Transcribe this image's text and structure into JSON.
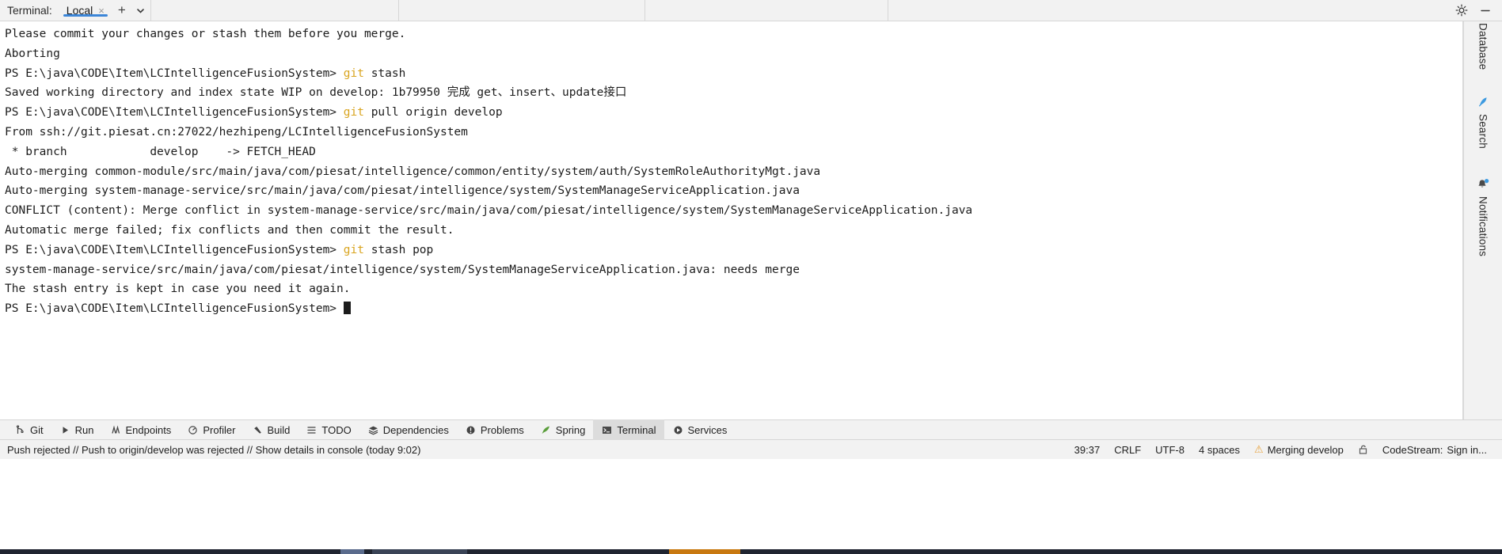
{
  "tabbar": {
    "label": "Terminal:",
    "tabs": [
      {
        "name": "Local",
        "close": "×",
        "active": true
      }
    ],
    "add_button": "+",
    "dropdown_button": "⌵",
    "settings_icon": "gear-icon",
    "minimize_icon": "minimize-icon"
  },
  "terminal": {
    "lines": [
      {
        "text": "Please commit your changes or stash them before you merge."
      },
      {
        "text": "Aborting"
      },
      {
        "prompt": "PS E:\\java\\CODE\\Item\\LCIntelligenceFusionSystem> ",
        "cmd_kw": "git",
        "cmd_rest": " stash"
      },
      {
        "text": "Saved working directory and index state WIP on develop: 1b79950 完成 get、insert、update接口"
      },
      {
        "prompt": "PS E:\\java\\CODE\\Item\\LCIntelligenceFusionSystem> ",
        "cmd_kw": "git",
        "cmd_rest": " pull origin develop"
      },
      {
        "text": "From ssh://git.piesat.cn:27022/hezhipeng/LCIntelligenceFusionSystem"
      },
      {
        "text": " * branch            develop    -> FETCH_HEAD"
      },
      {
        "text": "Auto-merging common-module/src/main/java/com/piesat/intelligence/common/entity/system/auth/SystemRoleAuthorityMgt.java"
      },
      {
        "text": "Auto-merging system-manage-service/src/main/java/com/piesat/intelligence/system/SystemManageServiceApplication.java"
      },
      {
        "text": "CONFLICT (content): Merge conflict in system-manage-service/src/main/java/com/piesat/intelligence/system/SystemManageServiceApplication.java"
      },
      {
        "text": "Automatic merge failed; fix conflicts and then commit the result."
      },
      {
        "prompt": "PS E:\\java\\CODE\\Item\\LCIntelligenceFusionSystem> ",
        "cmd_kw": "git",
        "cmd_rest": " stash pop"
      },
      {
        "text": "system-manage-service/src/main/java/com/piesat/intelligence/system/SystemManageServiceApplication.java: needs merge"
      },
      {
        "text": "The stash entry is kept in case you need it again."
      },
      {
        "prompt": "PS E:\\java\\CODE\\Item\\LCIntelligenceFusionSystem> ",
        "cursor": true
      }
    ]
  },
  "rightbar": {
    "items": [
      {
        "label": "Database",
        "icon": "database-icon"
      },
      {
        "label": "Search",
        "icon": "search-feather-icon"
      },
      {
        "label": "Notifications",
        "icon": "bell-icon"
      }
    ]
  },
  "bottombar": {
    "items": [
      {
        "label": "Git",
        "icon": "git-branch-icon",
        "active": false
      },
      {
        "label": "Run",
        "icon": "play-icon",
        "active": false
      },
      {
        "label": "Endpoints",
        "icon": "endpoints-icon",
        "active": false
      },
      {
        "label": "Profiler",
        "icon": "profiler-icon",
        "active": false
      },
      {
        "label": "Build",
        "icon": "hammer-icon",
        "active": false
      },
      {
        "label": "TODO",
        "icon": "list-icon",
        "active": false
      },
      {
        "label": "Dependencies",
        "icon": "layers-icon",
        "active": false
      },
      {
        "label": "Problems",
        "icon": "problems-icon",
        "active": false
      },
      {
        "label": "Spring",
        "icon": "spring-leaf-icon",
        "active": false
      },
      {
        "label": "Terminal",
        "icon": "terminal-icon",
        "active": true
      },
      {
        "label": "Services",
        "icon": "services-icon",
        "active": false
      }
    ]
  },
  "statusbar": {
    "message": "Push rejected // Push to origin/develop was rejected // Show details in console (today 9:02)",
    "caret": "39:37",
    "line_separator": "CRLF",
    "encoding": "UTF-8",
    "indent": "4 spaces",
    "branch": "Merging develop",
    "branch_icon": "warning-triangle-icon",
    "lock_icon": "unlock-icon",
    "codestream": "CodeStream:",
    "codestream_action": "Sign in..."
  },
  "colors": {
    "accent": "#3c86d8",
    "git_keyword": "#d9a520",
    "warning": "#e8a33d",
    "chrome": "#f2f2f2",
    "terminal_bg": "#ffffff",
    "terminal_fg": "#1c1c1c"
  }
}
